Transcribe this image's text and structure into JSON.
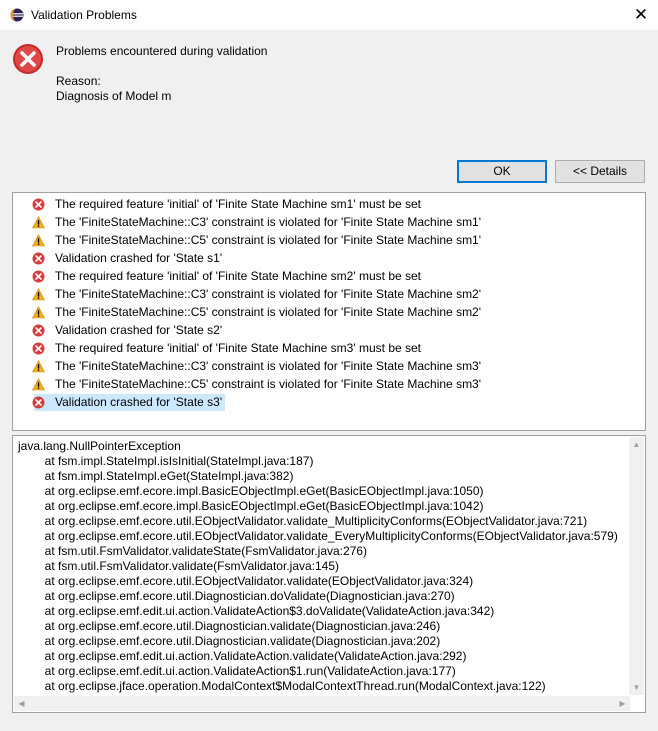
{
  "window": {
    "title": "Validation Problems",
    "close_glyph": "✕",
    "app_icon": "eclipse-icon"
  },
  "message": {
    "headline": "Problems encountered during validation",
    "reason_label": "Reason:",
    "reason_value": "Diagnosis of Model m",
    "icon": "error-icon"
  },
  "buttons": {
    "ok": "OK",
    "details": "<< Details"
  },
  "problems": [
    {
      "severity": "error",
      "text": "The required feature 'initial' of 'Finite State Machine sm1' must be set"
    },
    {
      "severity": "warning",
      "text": "The 'FiniteStateMachine::C3' constraint is violated for 'Finite State Machine sm1'"
    },
    {
      "severity": "warning",
      "text": "The 'FiniteStateMachine::C5' constraint is violated for 'Finite State Machine sm1'"
    },
    {
      "severity": "error",
      "text": "Validation crashed for 'State s1'"
    },
    {
      "severity": "error",
      "text": "The required feature 'initial' of 'Finite State Machine sm2' must be set"
    },
    {
      "severity": "warning",
      "text": "The 'FiniteStateMachine::C3' constraint is violated for 'Finite State Machine sm2'"
    },
    {
      "severity": "warning",
      "text": "The 'FiniteStateMachine::C5' constraint is violated for 'Finite State Machine sm2'"
    },
    {
      "severity": "error",
      "text": "Validation crashed for 'State s2'"
    },
    {
      "severity": "error",
      "text": "The required feature 'initial' of 'Finite State Machine sm3' must be set"
    },
    {
      "severity": "warning",
      "text": "The 'FiniteStateMachine::C3' constraint is violated for 'Finite State Machine sm3'"
    },
    {
      "severity": "warning",
      "text": "The 'FiniteStateMachine::C5' constraint is violated for 'Finite State Machine sm3'"
    },
    {
      "severity": "error",
      "text": "Validation crashed for 'State s3'",
      "selected": true
    }
  ],
  "stack_trace": [
    "java.lang.NullPointerException",
    "        at fsm.impl.StateImpl.isIsInitial(StateImpl.java:187)",
    "        at fsm.impl.StateImpl.eGet(StateImpl.java:382)",
    "        at org.eclipse.emf.ecore.impl.BasicEObjectImpl.eGet(BasicEObjectImpl.java:1050)",
    "        at org.eclipse.emf.ecore.impl.BasicEObjectImpl.eGet(BasicEObjectImpl.java:1042)",
    "        at org.eclipse.emf.ecore.util.EObjectValidator.validate_MultiplicityConforms(EObjectValidator.java:721)",
    "        at org.eclipse.emf.ecore.util.EObjectValidator.validate_EveryMultiplicityConforms(EObjectValidator.java:579)",
    "        at fsm.util.FsmValidator.validateState(FsmValidator.java:276)",
    "        at fsm.util.FsmValidator.validate(FsmValidator.java:145)",
    "        at org.eclipse.emf.ecore.util.EObjectValidator.validate(EObjectValidator.java:324)",
    "        at org.eclipse.emf.ecore.util.Diagnostician.doValidate(Diagnostician.java:270)",
    "        at org.eclipse.emf.edit.ui.action.ValidateAction$3.doValidate(ValidateAction.java:342)",
    "        at org.eclipse.emf.ecore.util.Diagnostician.validate(Diagnostician.java:246)",
    "        at org.eclipse.emf.ecore.util.Diagnostician.validate(Diagnostician.java:202)",
    "        at org.eclipse.emf.edit.ui.action.ValidateAction.validate(ValidateAction.java:292)",
    "        at org.eclipse.emf.edit.ui.action.ValidateAction$1.run(ValidateAction.java:177)",
    "        at org.eclipse.jface.operation.ModalContext$ModalContextThread.run(ModalContext.java:122)"
  ],
  "colors": {
    "error": "#d93a3a",
    "warning": "#f2b01e",
    "selection": "#cce8ff",
    "button_focus": "#0078d7"
  }
}
